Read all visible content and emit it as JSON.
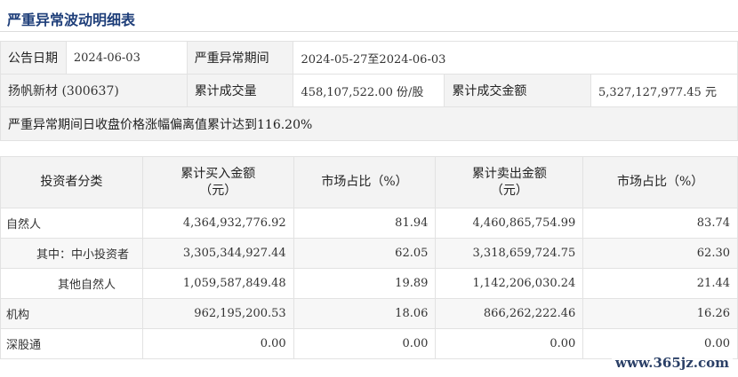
{
  "title": "严重异常波动明细表",
  "info": {
    "announce_date_label": "公告日期",
    "announce_date": "2024-06-03",
    "period_label": "严重异常期间",
    "period": "2024-05-27至2024-06-03",
    "stock": "扬帆新材 (300637)",
    "volume_label": "累计成交量",
    "volume": "458,107,522.00 份/股",
    "amount_label": "累计成交金额",
    "amount": "5,327,127,977.45 元",
    "deviation_note": "严重异常期间日收盘价格涨幅偏离值累计达到116.20%"
  },
  "detail": {
    "headers": [
      "投资者分类",
      "累计买入金额\n（元）",
      "市场占比（%）",
      "累计卖出金额\n（元）",
      "市场占比（%）"
    ],
    "rows": [
      {
        "category": "自然人",
        "buy": "4,364,932,776.92",
        "buy_pct": "81.94",
        "sell": "4,460,865,754.99",
        "sell_pct": "83.74"
      },
      {
        "category": "其中：中小投资者",
        "buy": "3,305,344,927.44",
        "buy_pct": "62.05",
        "sell": "3,318,659,724.75",
        "sell_pct": "62.30"
      },
      {
        "category": "其他自然人",
        "buy": "1,059,587,849.48",
        "buy_pct": "19.89",
        "sell": "1,142,206,030.24",
        "sell_pct": "21.44"
      },
      {
        "category": "机构",
        "buy": "962,195,200.53",
        "buy_pct": "18.06",
        "sell": "866,262,222.46",
        "sell_pct": "16.26"
      },
      {
        "category": "深股通",
        "buy": "0.00",
        "buy_pct": "0.00",
        "sell": "0.00",
        "sell_pct": "0.00"
      }
    ]
  },
  "watermark": "www.365jz.com"
}
